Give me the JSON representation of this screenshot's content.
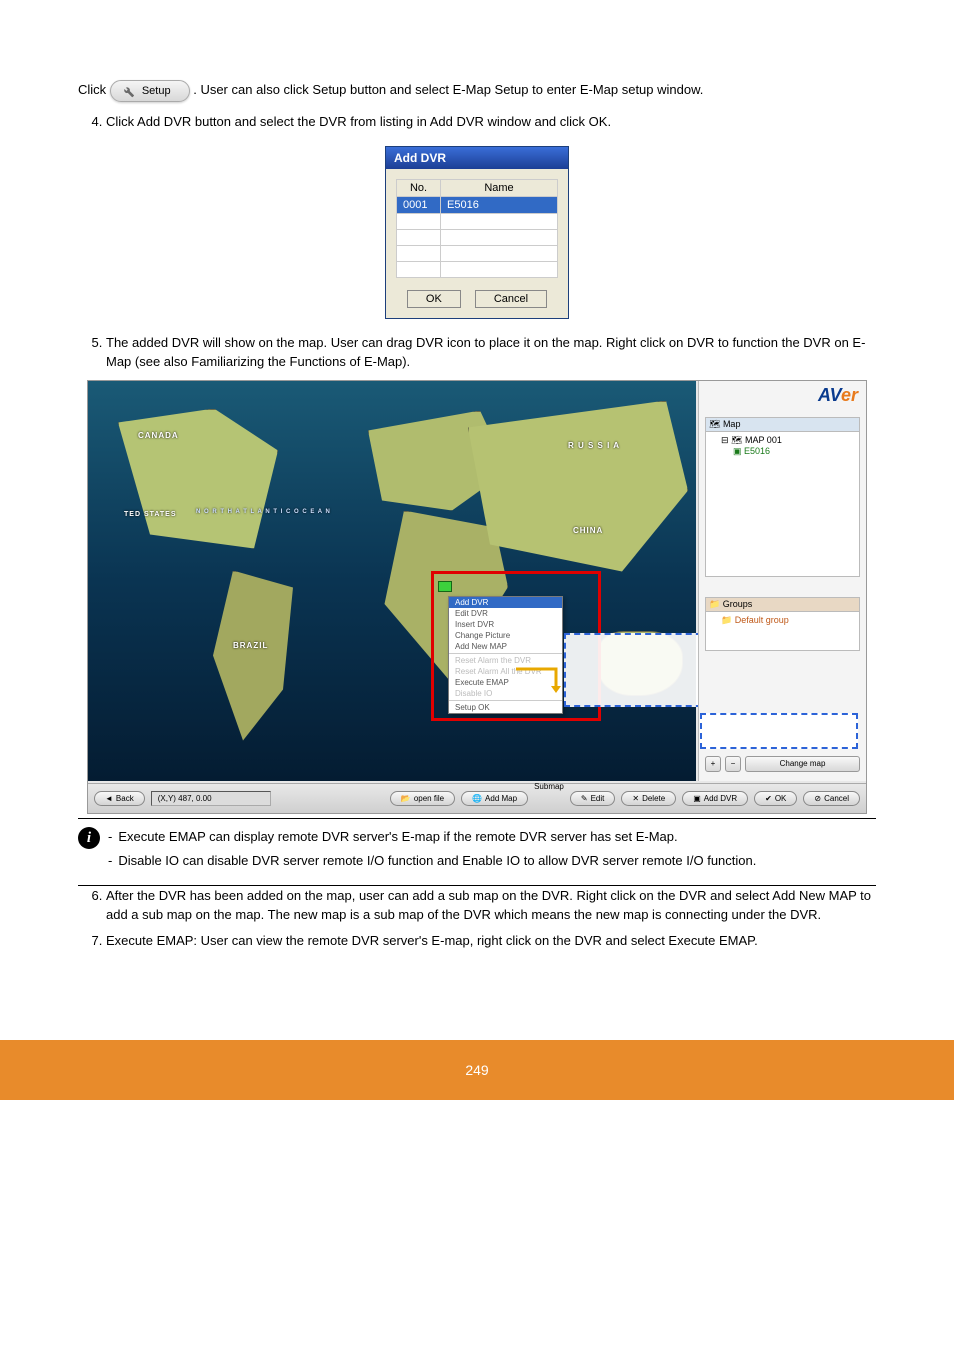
{
  "setup_button_label": "Setup",
  "p_before_setup": "Click ",
  "p_after_setup": ". User can also click Setup button and select E-Map Setup to enter E-Map setup window.",
  "steps": [
    "Click Add DVR button and select the DVR from listing in Add DVR window and click OK."
  ],
  "add_dvr_dialog": {
    "title": "Add DVR",
    "col_no": "No.",
    "col_name": "Name",
    "row_no": "0001",
    "row_name": "E5016",
    "ok": "OK",
    "cancel": "Cancel"
  },
  "step5": "The added DVR will show on the map. User can drag DVR icon to place it on the map. Right click on DVR to function the DVR on E-Map (see also Familiarizing the Functions of E-Map).",
  "step5_link": "Familiarizing the Functions of E-Map",
  "emap": {
    "brand_part1": "AV",
    "brand_part2": "er",
    "tree_header": "Map",
    "tree_item1": "MAP 001",
    "tree_item2": "E5016",
    "group_header": "Groups",
    "group_item": "Default group",
    "ctx": {
      "i0": "Add DVR",
      "i1": "Edit DVR",
      "i2": "Insert DVR",
      "i3": "Change Picture",
      "i4": "Add New MAP",
      "i5": "Reset Alarm the DVR",
      "i6": "Reset Alarm All the DVR",
      "i7": "Execute EMAP",
      "i8": "Disable IO",
      "i9": "Setup OK"
    },
    "change_map_btn": "Change map",
    "map_labels": {
      "canada": "CANADA",
      "us": "TED STATES",
      "brazil": "BRAZIL",
      "russia": "R U S S I A",
      "china": "CHINA",
      "na_ocean": "N O R T H\nA T L A N T I C\nO C E A N"
    },
    "bottombar": {
      "back": "Back",
      "coord": "(X,Y) 487, 0.00",
      "openfile": "open file",
      "addmap": "Add Map",
      "submap_label": "Submap",
      "edit": "Edit",
      "delete": "Delete",
      "adddvr": "Add DVR",
      "ok": "OK",
      "cancel": "Cancel"
    }
  },
  "notes": [
    "Execute EMAP can display remote DVR server's E-map if the remote DVR server has set E-Map.",
    "Disable IO can disable DVR server remote I/O function and Enable IO to allow DVR server remote I/O function."
  ],
  "step6": "After the DVR has been added on the map, user can add a sub map on the DVR. Right click on the DVR and select Add New MAP to add a sub map on the map. The new map is a sub map of the DVR which means the new map is connecting under the DVR.",
  "step7_part1": "Execute EMAP: User can view the ",
  "step7_part2": "remote DVR server's E",
  "step7_part3": "-map, right click on the DVR and select Execute EMAP.",
  "page_number": "249"
}
